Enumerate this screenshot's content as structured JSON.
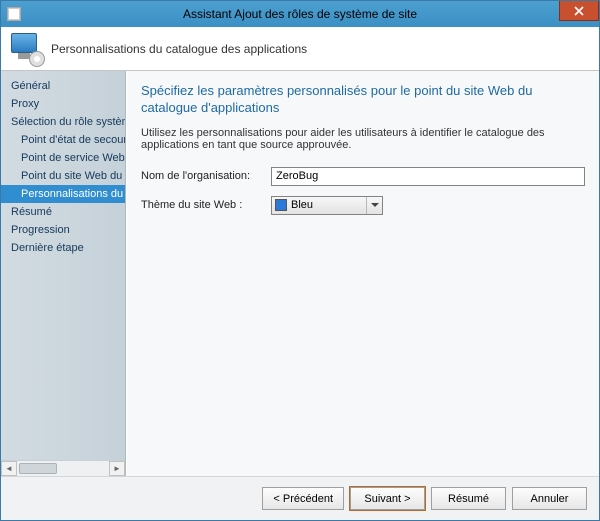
{
  "window": {
    "title": "Assistant Ajout des rôles de système de site"
  },
  "header": {
    "subtitle": "Personnalisations du catalogue des applications"
  },
  "sidebar": {
    "items": [
      {
        "label": "Général",
        "child": false,
        "selected": false
      },
      {
        "label": "Proxy",
        "child": false,
        "selected": false
      },
      {
        "label": "Sélection du rôle système",
        "child": false,
        "selected": false
      },
      {
        "label": "Point d'état de secours",
        "child": true,
        "selected": false
      },
      {
        "label": "Point de service Web du catalogue des applications",
        "child": true,
        "selected": false
      },
      {
        "label": "Point du site Web du catalogue des applications",
        "child": true,
        "selected": false
      },
      {
        "label": "Personnalisations du catalogue des applications",
        "child": true,
        "selected": true
      },
      {
        "label": "Résumé",
        "child": false,
        "selected": false
      },
      {
        "label": "Progression",
        "child": false,
        "selected": false
      },
      {
        "label": "Dernière étape",
        "child": false,
        "selected": false
      }
    ]
  },
  "main": {
    "heading": "Spécifiez les paramètres personnalisés pour le point du site Web du catalogue d'applications",
    "description": "Utilisez les personnalisations pour aider les utilisateurs à identifier le catalogue des applications en tant que source approuvée.",
    "org_label": "Nom de l'organisation:",
    "org_value": "ZeroBug",
    "theme_label": "Thème du site Web :",
    "theme_value": "Bleu"
  },
  "buttons": {
    "prev": "< Précédent",
    "next": "Suivant >",
    "summary": "Résumé",
    "cancel": "Annuler"
  }
}
